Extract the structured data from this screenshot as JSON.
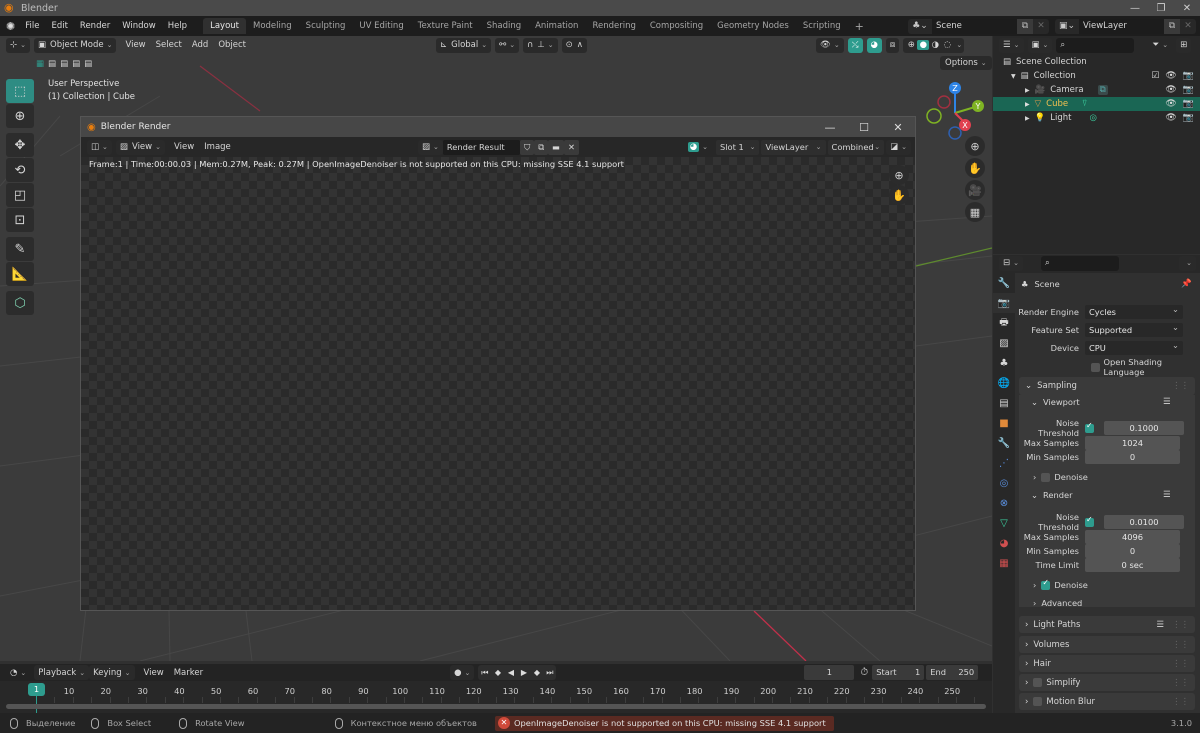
{
  "window": {
    "title": "Blender",
    "controls": [
      "minimize",
      "maximize",
      "close"
    ]
  },
  "menubar": {
    "items": [
      "File",
      "Edit",
      "Render",
      "Window",
      "Help"
    ],
    "workspaces": [
      "Layout",
      "Modeling",
      "Sculpting",
      "UV Editing",
      "Texture Paint",
      "Shading",
      "Animation",
      "Rendering",
      "Compositing",
      "Geometry Nodes",
      "Scripting"
    ],
    "active_workspace": "Layout",
    "add_workspace": "+",
    "scene": "Scene",
    "view_layer": "ViewLayer"
  },
  "viewport": {
    "mode": "Object Mode",
    "menus": [
      "View",
      "Select",
      "Add",
      "Object"
    ],
    "orientation": "Global",
    "options_label": "Options",
    "overlay_title": "User Perspective",
    "overlay_sub": "(1) Collection | Cube",
    "gizmo_axes": {
      "x": "X",
      "y": "Y",
      "z": "Z"
    },
    "colors": {
      "x": "#e0404f",
      "y": "#7fb323",
      "z": "#2e84e6",
      "accent": "#2e9c8e"
    }
  },
  "render_window": {
    "title": "Blender Render",
    "menus": [
      "View",
      "Image"
    ],
    "view_dropdown": "View",
    "image_name": "Render Result",
    "slot": "Slot 1",
    "view_layer": "ViewLayer",
    "pass": "Combined",
    "info": "Frame:1 | Time:00:00.03 | Mem:0.27M, Peak: 0.27M | OpenImageDenoiser is not supported on this CPU: missing SSE 4.1 support"
  },
  "outliner": {
    "root": "Scene Collection",
    "collection": "Collection",
    "items": [
      {
        "name": "Camera",
        "icon": "camera-icon",
        "selected": false
      },
      {
        "name": "Cube",
        "icon": "mesh-icon",
        "selected": true
      },
      {
        "name": "Light",
        "icon": "light-icon",
        "selected": false
      }
    ]
  },
  "properties": {
    "context": "Scene",
    "render_engine_label": "Render Engine",
    "render_engine": "Cycles",
    "feature_set_label": "Feature Set",
    "feature_set": "Supported",
    "device_label": "Device",
    "device": "CPU",
    "osl_label": "Open Shading Language",
    "sampling": {
      "title": "Sampling",
      "viewport": {
        "title": "Viewport",
        "noise_threshold_label": "Noise Threshold",
        "noise_threshold": "0.1000",
        "max_samples_label": "Max Samples",
        "max_samples": "1024",
        "min_samples_label": "Min Samples",
        "min_samples": "0",
        "denoise_label": "Denoise",
        "denoise": false
      },
      "render": {
        "title": "Render",
        "noise_threshold_label": "Noise Threshold",
        "noise_threshold": "0.0100",
        "max_samples_label": "Max Samples",
        "max_samples": "4096",
        "min_samples_label": "Min Samples",
        "min_samples": "0",
        "time_limit_label": "Time Limit",
        "time_limit": "0 sec",
        "denoise_label": "Denoise",
        "denoise": true
      },
      "advanced": "Advanced"
    },
    "panels": [
      "Light Paths",
      "Volumes",
      "Hair",
      "Simplify",
      "Motion Blur"
    ]
  },
  "timeline": {
    "menus": [
      "Playback",
      "Keying",
      "View",
      "Marker"
    ],
    "current_frame": "1",
    "start_label": "Start",
    "start": "1",
    "end_label": "End",
    "end": "250",
    "ruler": [
      "10",
      "20",
      "30",
      "40",
      "50",
      "60",
      "70",
      "80",
      "90",
      "100",
      "110",
      "120",
      "130",
      "140",
      "150",
      "160",
      "170",
      "180",
      "190",
      "200",
      "210",
      "220",
      "230",
      "240",
      "250"
    ]
  },
  "statusbar": {
    "select": "Выделение",
    "box_select": "Box Select",
    "rotate": "Rotate View",
    "context_menu": "Контекстное меню объектов",
    "error": "OpenImageDenoiser is not supported on this CPU: missing SSE 4.1 support",
    "version": "3.1.0"
  }
}
